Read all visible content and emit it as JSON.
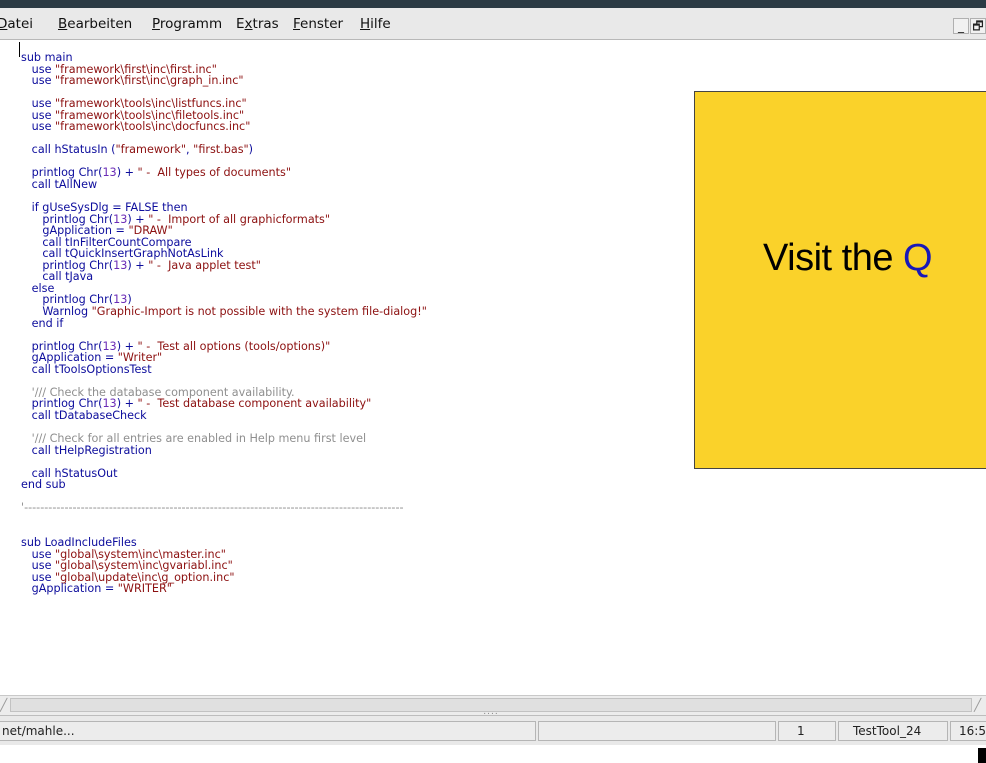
{
  "menu": {
    "items": [
      {
        "name": "menu-datei",
        "label": "Datei",
        "underline": "D",
        "clipped": true
      },
      {
        "name": "menu-bearbeiten",
        "label": "Bearbeiten",
        "underline": "B"
      },
      {
        "name": "menu-programm",
        "label": "Programm",
        "underline": "P"
      },
      {
        "name": "menu-extras",
        "label": "Extras",
        "underline": "x"
      },
      {
        "name": "menu-fenster",
        "label": "Fenster",
        "underline": "F"
      },
      {
        "name": "menu-hilfe",
        "label": "Hilfe",
        "underline": "H"
      }
    ],
    "minimize_glyph": "_",
    "restore_glyph": "🗗"
  },
  "banner": {
    "text_prefix": "Visit the ",
    "text_highlight": "Q"
  },
  "code_lines": [
    [
      [
        "sub main",
        "p"
      ]
    ],
    [
      [
        "   use ",
        "p"
      ],
      [
        "\"framework\\first\\inc\\first.inc\"",
        "s"
      ]
    ],
    [
      [
        "   use ",
        "p"
      ],
      [
        "\"framework\\first\\inc\\graph_in.inc\"",
        "s"
      ]
    ],
    [],
    [
      [
        "   use ",
        "p"
      ],
      [
        "\"framework\\tools\\inc\\listfuncs.inc\"",
        "s"
      ]
    ],
    [
      [
        "   use ",
        "p"
      ],
      [
        "\"framework\\tools\\inc\\filetools.inc\"",
        "s"
      ]
    ],
    [
      [
        "   use ",
        "p"
      ],
      [
        "\"framework\\tools\\inc\\docfuncs.inc\"",
        "s"
      ]
    ],
    [],
    [
      [
        "   call hStatusIn (",
        "p"
      ],
      [
        "\"framework\"",
        "s"
      ],
      [
        ", ",
        "p"
      ],
      [
        "\"first.bas\"",
        "s"
      ],
      [
        ")",
        "p"
      ]
    ],
    [],
    [
      [
        "   printlog Chr(",
        "p"
      ],
      [
        "13",
        "n"
      ],
      [
        ") + ",
        "p"
      ],
      [
        "\" -  All types of documents\"",
        "s"
      ]
    ],
    [
      [
        "   call tAllNew",
        "p"
      ]
    ],
    [],
    [
      [
        "   if gUseSysDlg = FALSE then",
        "p"
      ]
    ],
    [
      [
        "      printlog Chr(",
        "p"
      ],
      [
        "13",
        "n"
      ],
      [
        ") + ",
        "p"
      ],
      [
        "\" -  Import of all graphicformats\"",
        "s"
      ]
    ],
    [
      [
        "      gApplication = ",
        "p"
      ],
      [
        "\"DRAW\"",
        "s"
      ]
    ],
    [
      [
        "      call tInFilterCountCompare",
        "p"
      ]
    ],
    [
      [
        "      call tQuickInsertGraphNotAsLink",
        "p"
      ]
    ],
    [
      [
        "      printlog Chr(",
        "p"
      ],
      [
        "13",
        "n"
      ],
      [
        ") + ",
        "p"
      ],
      [
        "\" -  Java applet test\"",
        "s"
      ]
    ],
    [
      [
        "      call tJava",
        "p"
      ]
    ],
    [
      [
        "   else",
        "p"
      ]
    ],
    [
      [
        "      printlog Chr(",
        "p"
      ],
      [
        "13",
        "n"
      ],
      [
        ")",
        "p"
      ]
    ],
    [
      [
        "      Warnlog ",
        "p"
      ],
      [
        "\"Graphic-Import is not possible with the system file-dialog!\"",
        "s"
      ]
    ],
    [
      [
        "   end if",
        "p"
      ]
    ],
    [],
    [
      [
        "   printlog Chr(",
        "p"
      ],
      [
        "13",
        "n"
      ],
      [
        ") + ",
        "p"
      ],
      [
        "\" -  Test all options (tools/options)\"",
        "s"
      ]
    ],
    [
      [
        "   gApplication = ",
        "p"
      ],
      [
        "\"Writer\"",
        "s"
      ]
    ],
    [
      [
        "   call tToolsOptionsTest",
        "p"
      ]
    ],
    [],
    [
      [
        "   '/// Check the database component availability.",
        "c"
      ]
    ],
    [
      [
        "   printlog Chr(",
        "p"
      ],
      [
        "13",
        "n"
      ],
      [
        ") + ",
        "p"
      ],
      [
        "\" -  Test database component availability\"",
        "s"
      ]
    ],
    [
      [
        "   call tDatabaseCheck",
        "p"
      ]
    ],
    [],
    [
      [
        "   '/// Check for all entries are enabled in Help menu first level",
        "c"
      ]
    ],
    [
      [
        "   call tHelpRegistration",
        "p"
      ]
    ],
    [],
    [
      [
        "   call hStatusOut",
        "p"
      ]
    ],
    [
      [
        "end sub",
        "p"
      ]
    ],
    [],
    [
      [
        "'----------------------------------------------------------------------------------------------",
        "c"
      ]
    ],
    [],
    [],
    [
      [
        "sub LoadIncludeFiles",
        "p"
      ]
    ],
    [
      [
        "   use ",
        "p"
      ],
      [
        "\"global\\system\\inc\\master.inc\"",
        "s"
      ]
    ],
    [
      [
        "   use ",
        "p"
      ],
      [
        "\"global\\system\\inc\\gvariabl.inc\"",
        "s"
      ]
    ],
    [
      [
        "   use ",
        "p"
      ],
      [
        "\"global\\update\\inc\\g_option.inc\"",
        "s"
      ]
    ],
    [
      [
        "   gApplication = ",
        "p"
      ],
      [
        "\"WRITER\"",
        "s"
      ]
    ]
  ],
  "scrollbar": {
    "grip": "....",
    "left_arrow": "╱",
    "right_arrow": "╱"
  },
  "status": {
    "path": "net/mahle...",
    "line": "1",
    "app": "TestTool_24",
    "time": "16:5"
  }
}
